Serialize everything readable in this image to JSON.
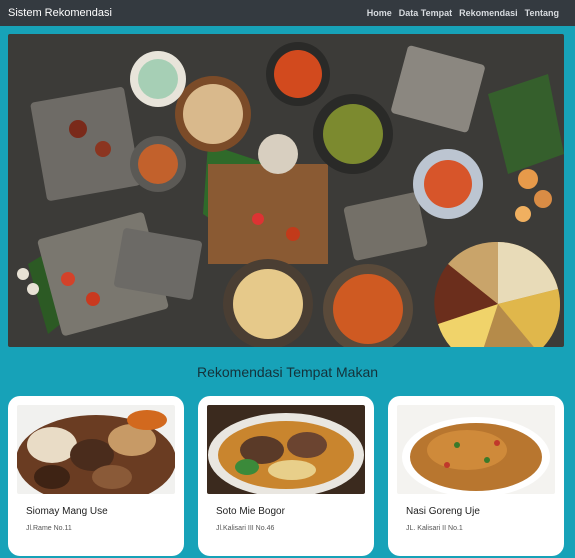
{
  "navbar": {
    "brand": "Sistem Rekomendasi",
    "links": [
      "Home",
      "Data Tempat",
      "Rekomendasi",
      "Tentang"
    ]
  },
  "section": {
    "title": "Rekomendasi Tempat Makan"
  },
  "cards": [
    {
      "name": "Siomay Mang Use",
      "address": "Jl.Rame No.11"
    },
    {
      "name": "Soto Mie Bogor",
      "address": "Jl.Kalisari III No.46"
    },
    {
      "name": "Nasi Goreng Uje",
      "address": "JL. Kalisari II No.1"
    }
  ]
}
